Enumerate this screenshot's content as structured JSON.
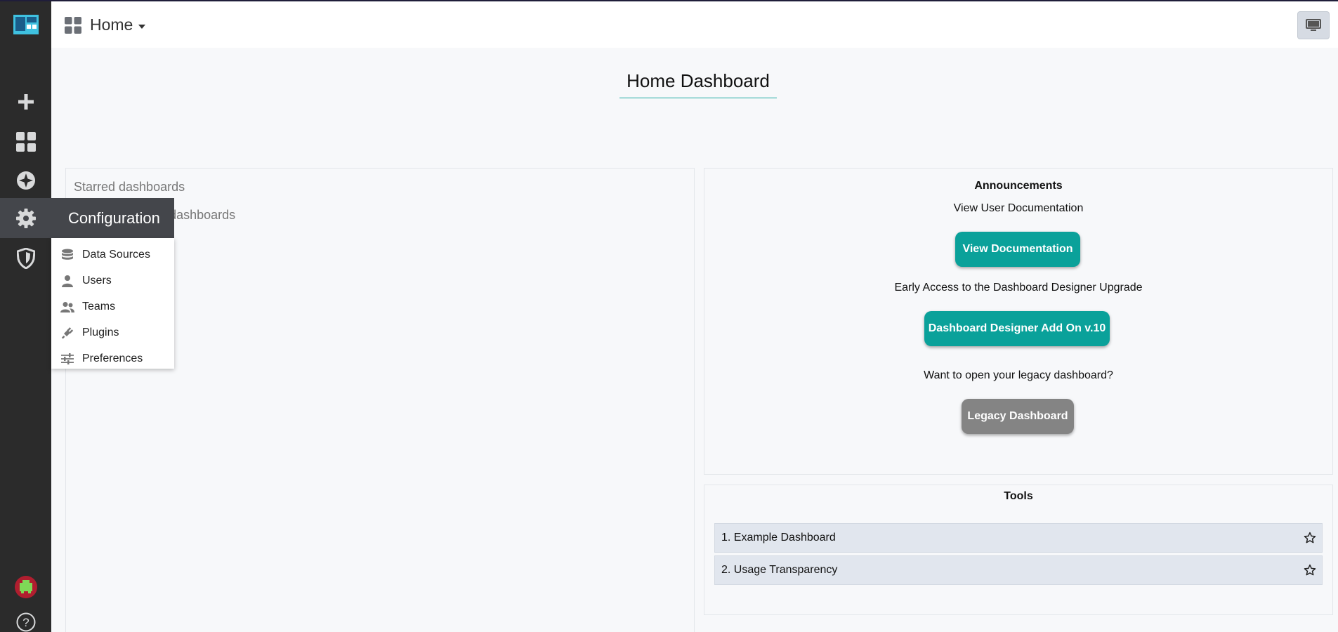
{
  "sidebar": {
    "items": [
      {
        "icon": "plus-icon"
      },
      {
        "icon": "dashboards-icon"
      },
      {
        "icon": "explore-icon"
      },
      {
        "icon": "gear-icon"
      },
      {
        "icon": "shield-icon"
      },
      {
        "icon": "user-avatar-icon"
      },
      {
        "icon": "help-icon"
      }
    ]
  },
  "topbar": {
    "home_label": "Home"
  },
  "page": {
    "title": "Home Dashboard"
  },
  "starred": {
    "title": "Starred dashboards",
    "recent_title": "Recently viewed dashboards"
  },
  "announcements": {
    "title": "Announcements",
    "docs_text": "View User Documentation",
    "docs_button": "View Documentation",
    "early_text": "Early Access to the Dashboard Designer Upgrade",
    "designer_button": "Dashboard Designer Add On v.10",
    "legacy_text": "Want to open your legacy dashboard?",
    "legacy_button": "Legacy Dashboard"
  },
  "tools": {
    "title": "Tools",
    "items": [
      {
        "label": "1. Example Dashboard"
      },
      {
        "label": "2. Usage Transparency"
      }
    ]
  },
  "config_menu": {
    "header": "Configuration",
    "items": [
      {
        "label": "Data Sources",
        "icon": "database-icon"
      },
      {
        "label": "Users",
        "icon": "user-icon"
      },
      {
        "label": "Teams",
        "icon": "users-icon"
      },
      {
        "label": "Plugins",
        "icon": "plug-icon"
      },
      {
        "label": "Preferences",
        "icon": "sliders-icon"
      }
    ]
  },
  "colors": {
    "sidebar_bg": "#2b2b2b",
    "accent_teal": "#0aa19a",
    "legacy_gray": "#848484"
  }
}
